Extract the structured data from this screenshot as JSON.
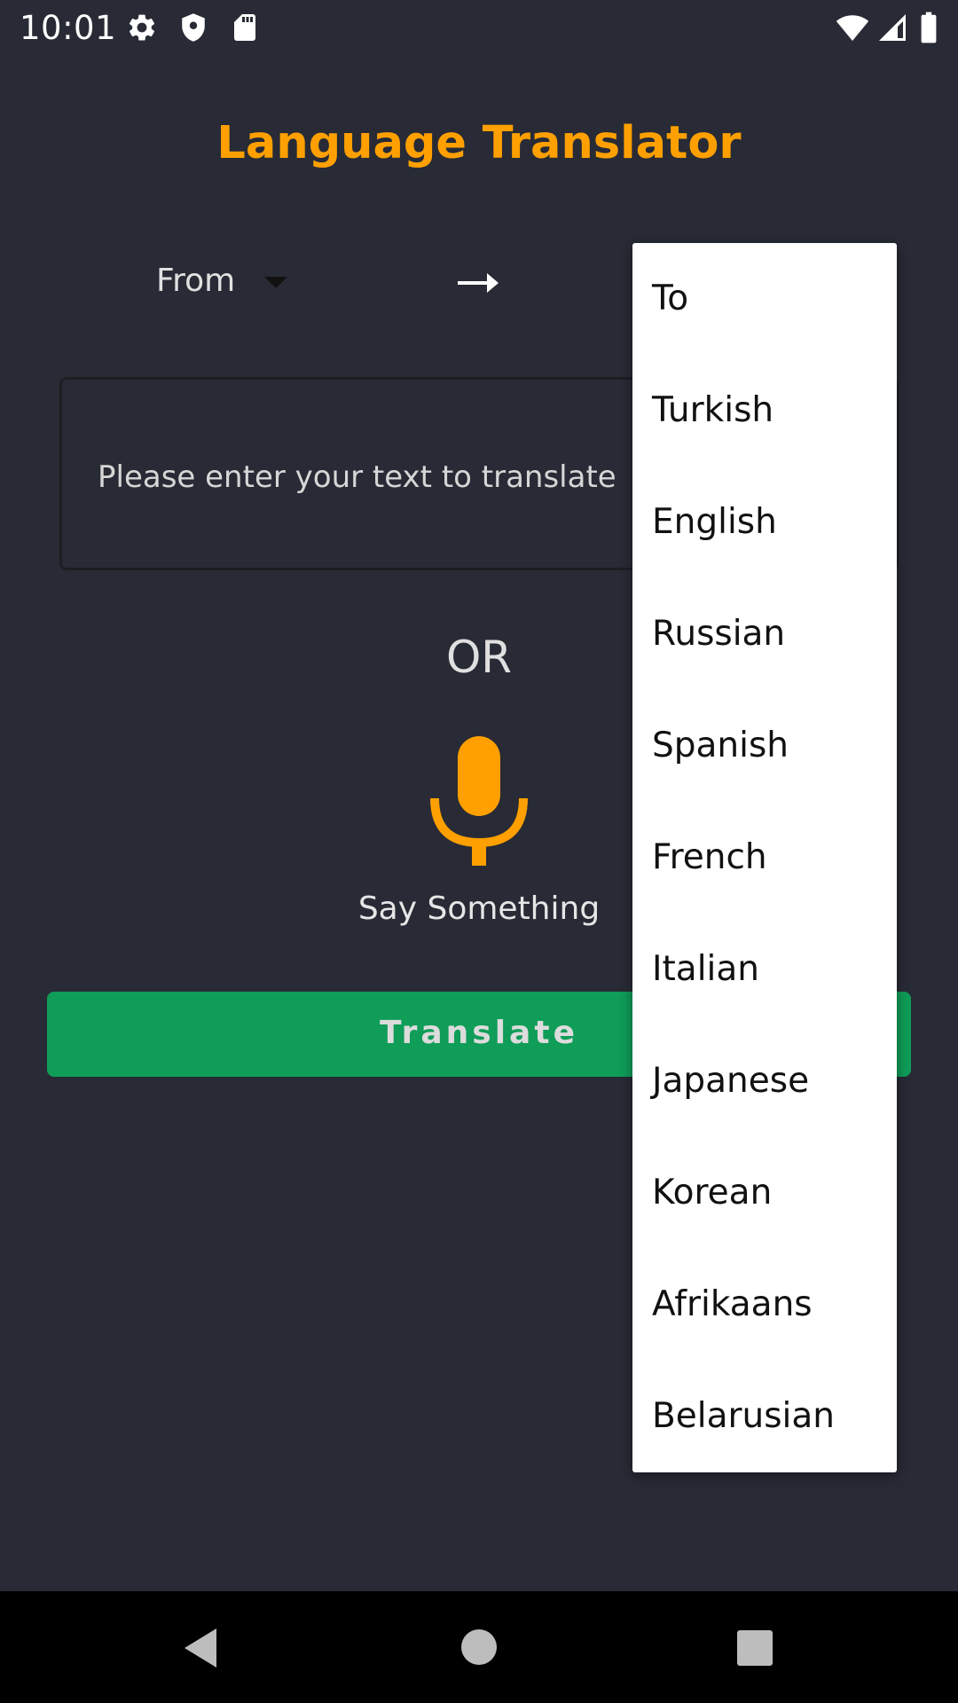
{
  "status_bar": {
    "time": "10:01",
    "icons": [
      "gear-icon",
      "shield-icon",
      "sd-card-icon",
      "wifi-icon",
      "signal-icon",
      "battery-icon"
    ]
  },
  "app": {
    "title": "Language Translator",
    "title_color": "#ffa000"
  },
  "from_spinner": {
    "label": "From"
  },
  "input": {
    "placeholder": "Please enter your text to translate"
  },
  "or_label": "OR",
  "voice": {
    "label": "Say Something",
    "icon": "microphone-icon",
    "color": "#ffa000"
  },
  "translate_button": {
    "label": "Translate",
    "color": "#0f9d58"
  },
  "to_dropdown": {
    "items": [
      "To",
      "Turkish",
      "English",
      "Russian",
      "Spanish",
      "French",
      "Italian",
      "Japanese",
      "Korean",
      "Afrikaans",
      "Belarusian"
    ]
  },
  "nav_bar": {
    "icons": [
      "back-icon",
      "home-icon",
      "recents-icon"
    ]
  }
}
